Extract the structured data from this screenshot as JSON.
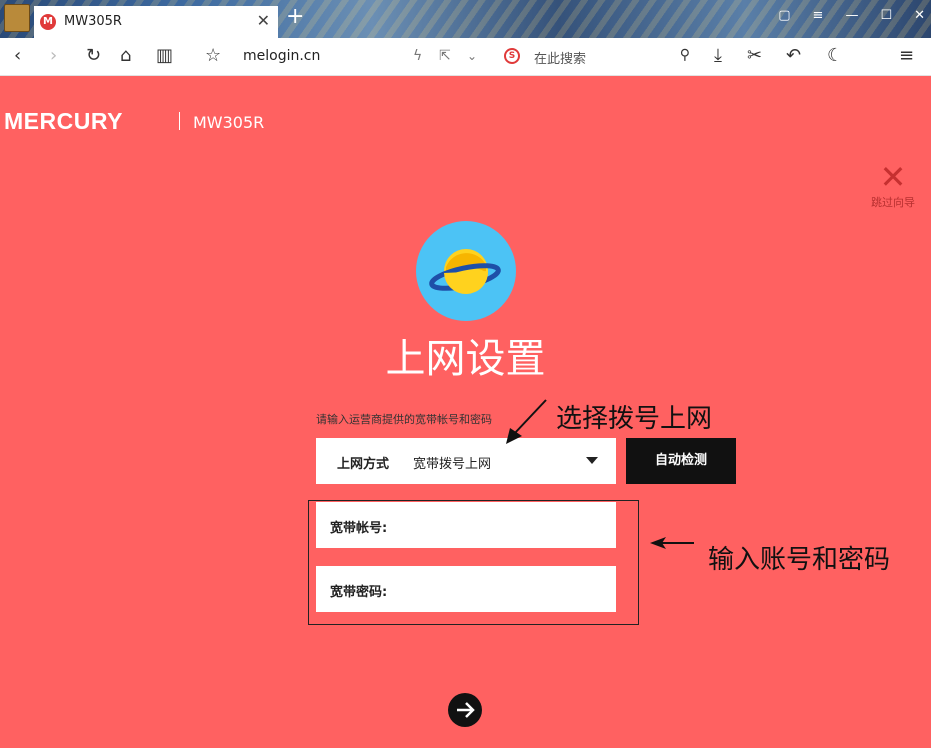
{
  "browser": {
    "tab": {
      "favicon": "M",
      "title": "MW305R"
    },
    "url": "melogin.cn",
    "search": {
      "engine_glyph": "S",
      "placeholder": "在此搜索"
    }
  },
  "page": {
    "brand": "MERCURY",
    "model": "MW305R",
    "skip_label": "跳过向导",
    "title": "上网设置",
    "hint": "请输入运营商提供的宽带帐号和密码",
    "connection": {
      "label": "上网方式",
      "value": "宽带拨号上网"
    },
    "detect_button": "自动检测",
    "account_label": "宽带帐号:",
    "password_label": "宽带密码:"
  },
  "annotations": {
    "select_dialup": "选择拨号上网",
    "enter_credentials": "输入账号和密码"
  },
  "colors": {
    "page_bg": "#ff6161",
    "button": "#111111",
    "accent": "#e03a3a"
  }
}
